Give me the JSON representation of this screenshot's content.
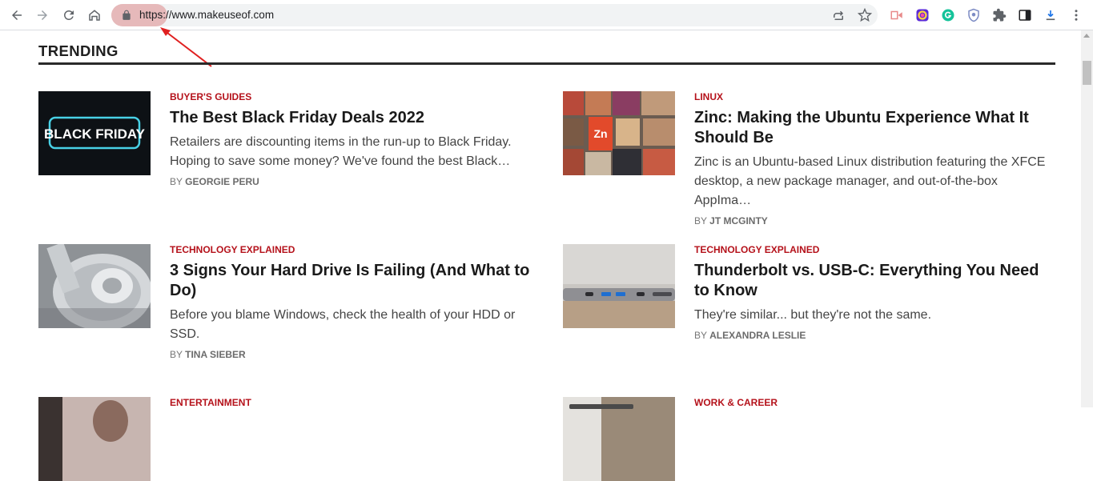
{
  "browser": {
    "url": "https://www.makeuseof.com",
    "nav_icons": [
      "back-icon",
      "forward-icon",
      "reload-icon",
      "home-icon"
    ],
    "omnibox_icons": [
      "lock-icon",
      "share-icon",
      "star-icon"
    ],
    "extension_icons": [
      "video-ext-icon",
      "color-ext-icon",
      "grammarly-icon",
      "shield-ext-icon",
      "puzzle-icon",
      "sidepanel-icon",
      "download-icon",
      "more-menu-icon"
    ],
    "highlight_color": "#d66868",
    "annotation_arrow_color": "#e02020"
  },
  "section": {
    "title": "TRENDING"
  },
  "articles": [
    {
      "category": "BUYER'S GUIDES",
      "title": "The Best Black Friday Deals 2022",
      "excerpt": "Retailers are discounting items in the run-up to Black Friday. Hoping to save some money? We've found the best Black…",
      "by": "BY",
      "author": "GEORGIE PERU",
      "thumb_text": "BLACK FRIDAY"
    },
    {
      "category": "LINUX",
      "title": "Zinc: Making the Ubuntu Experience What It Should Be",
      "excerpt": "Zinc is an Ubuntu-based Linux distribution featuring the XFCE desktop, a new package manager, and out-of-the-box AppIma…",
      "by": "BY",
      "author": "JT MCGINTY",
      "thumb_text": "Zn"
    },
    {
      "category": "TECHNOLOGY EXPLAINED",
      "title": "3 Signs Your Hard Drive Is Failing (And What to Do)",
      "excerpt": "Before you blame Windows, check the health of your HDD or SSD.",
      "by": "BY",
      "author": "TINA SIEBER"
    },
    {
      "category": "TECHNOLOGY EXPLAINED",
      "title": "Thunderbolt vs. USB-C: Everything You Need to Know",
      "excerpt": "They're similar... but they're not the same.",
      "by": "BY",
      "author": "ALEXANDRA LESLIE"
    },
    {
      "category": "ENTERTAINMENT"
    },
    {
      "category": "WORK & CAREER"
    }
  ],
  "colors": {
    "category_red": "#b5121b",
    "heading_dark": "#1a1a1a",
    "rule_dark": "#2a2a2a"
  }
}
